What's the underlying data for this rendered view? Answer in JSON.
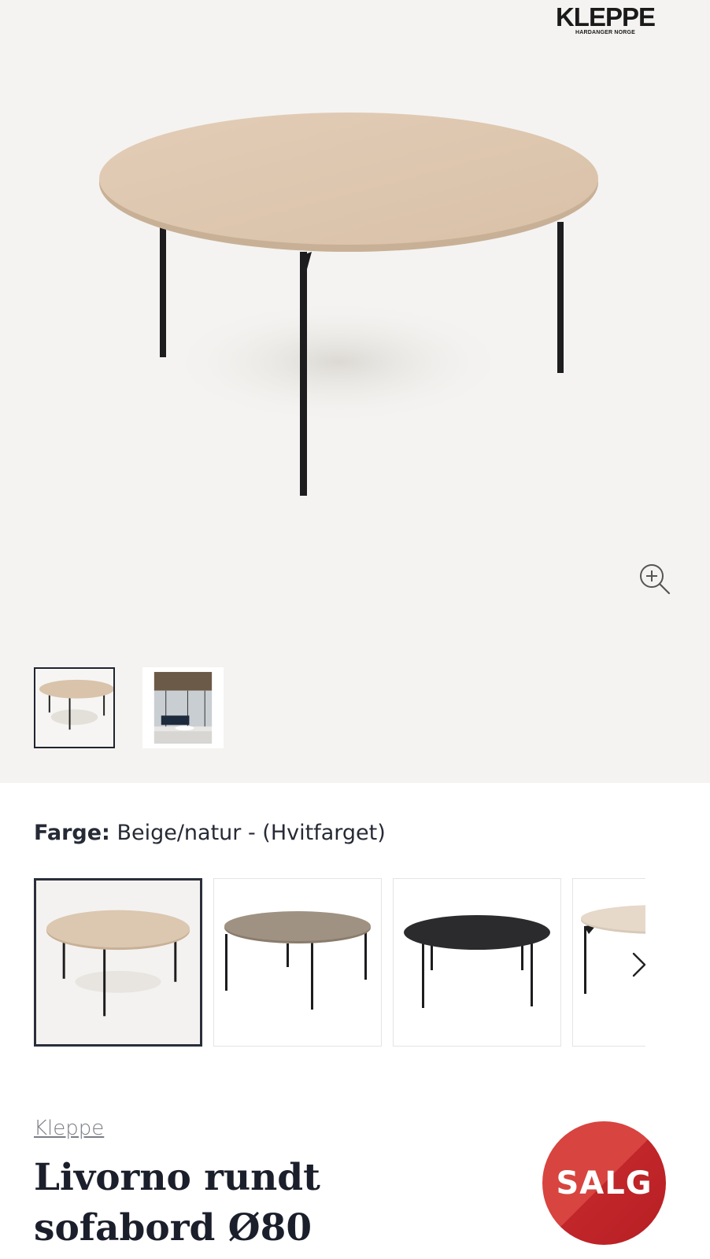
{
  "brand": {
    "logo_text": "KLEPPE",
    "logo_subtitle": "HARDANGER NORGE"
  },
  "gallery": {
    "main_image_alt": "Livorno rundt sofabord",
    "thumbnails": [
      {
        "name": "table-product-photo",
        "selected": true
      },
      {
        "name": "living-room-photo",
        "selected": false
      }
    ],
    "zoom_icon": "zoom-in-icon"
  },
  "color": {
    "label": "Farge:",
    "value": "Beige/natur - (Hvitfarget)",
    "swatches": [
      {
        "name": "beige-natur",
        "top_color": "#dcc7b0",
        "selected": true
      },
      {
        "name": "brown-grey",
        "top_color": "#9d8f7f",
        "selected": false
      },
      {
        "name": "black",
        "top_color": "#2b2b2d",
        "selected": false
      },
      {
        "name": "light-partial",
        "top_color": "#e4d6c7",
        "selected": false
      }
    ],
    "next_icon": "chevron-right-icon"
  },
  "product": {
    "brand_link": "Kleppe",
    "title": "Livorno rundt sofabord Ø80",
    "badge": "SALG"
  },
  "colors": {
    "gallery_bg": "#f4f3f1",
    "title": "#1b1f2b",
    "badge_red": "#c92f30"
  }
}
